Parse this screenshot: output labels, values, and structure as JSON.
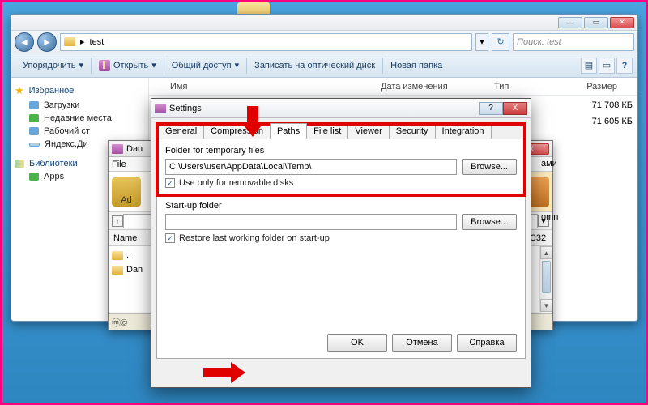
{
  "desktop": {
    "item_label": ""
  },
  "explorer": {
    "breadcrumb": "test",
    "search_placeholder": "Поиск: test",
    "toolbar": {
      "organize": "Упорядочить",
      "open": "Открыть",
      "share": "Общий доступ",
      "burn": "Записать на оптический диск",
      "new_folder": "Новая папка"
    },
    "sidebar": {
      "favorites": "Избранное",
      "downloads": "Загрузки",
      "recent": "Недавние места",
      "desktop": "Рабочий ст",
      "yandex": "Яндекс.Ди",
      "libraries": "Библиотеки",
      "apps": "Apps"
    },
    "columns": {
      "name": "Имя",
      "modified": "Дата изменения",
      "type": "Тип",
      "size": "Размер"
    },
    "rows": [
      {
        "size": "71 708 КБ"
      },
      {
        "size": "71 605 КБ"
      }
    ]
  },
  "winrar": {
    "title": "Dan",
    "menu_file": "File",
    "toolbar_add": "Ad",
    "col_name": "Name",
    "rows": [
      "..",
      "Dan"
    ],
    "status": "ⓜ©",
    "right_cols": [
      "ами",
      "omn",
      "CRC32"
    ]
  },
  "settings": {
    "title": "Settings",
    "tabs": [
      "General",
      "Compression",
      "Paths",
      "File list",
      "Viewer",
      "Security",
      "Integration"
    ],
    "active_tab": "Paths",
    "group_temp": "Folder for temporary files",
    "temp_path": "C:\\Users\\user\\AppData\\Local\\Temp\\",
    "browse": "Browse...",
    "chk_removable": "Use only for removable disks",
    "group_startup": "Start-up folder",
    "startup_path": "",
    "chk_restore": "Restore last working folder on start-up",
    "ok": "OK",
    "cancel": "Отмена",
    "help": "Справка"
  }
}
